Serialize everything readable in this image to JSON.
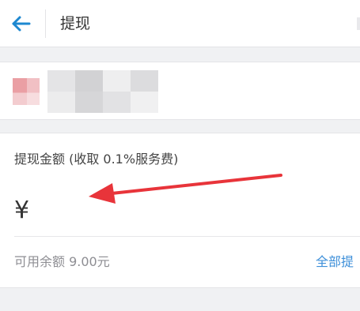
{
  "header": {
    "title": "提现",
    "back_icon": "arrow-left-icon",
    "accent": "#1e88d0"
  },
  "bank_card": {
    "icon": "bank-logo-icon",
    "info_obscured": true
  },
  "withdraw": {
    "amount_label": "提现金额 (收取 0.1%服务费)",
    "currency_symbol": "¥",
    "amount_value": "",
    "available_text": "可用余额 9.00元",
    "withdraw_all_label": "全部提",
    "link_color": "#3d8fd9"
  },
  "annotation": {
    "type": "red-arrow",
    "color": "#e8343a"
  }
}
